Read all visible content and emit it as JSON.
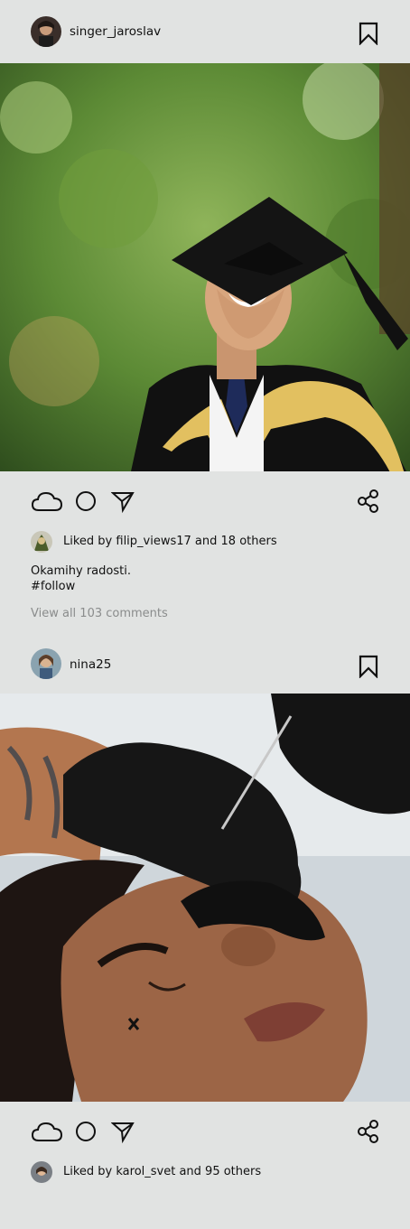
{
  "posts": [
    {
      "username": "singer_jaroslav",
      "liked_by_text": "Liked by filip_views17 and 18 others",
      "caption_line1": "Okamihy radosti.",
      "caption_line2": "#follow",
      "view_comments": "View all 103 comments"
    },
    {
      "username": "nina25",
      "liked_by_text": "Liked by karol_svet and 95 others"
    }
  ],
  "icons": {
    "bookmark": "bookmark-icon",
    "like": "cloud-icon",
    "comment": "circle-icon",
    "send": "send-icon",
    "share": "share-icon"
  }
}
